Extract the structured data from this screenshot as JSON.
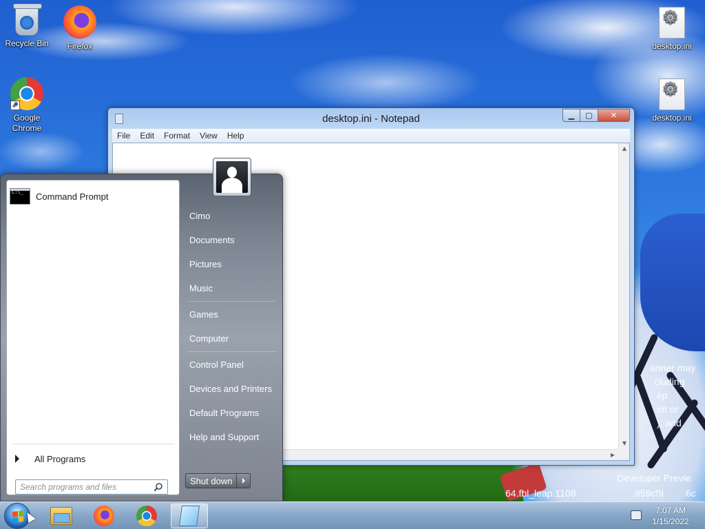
{
  "desktop": {
    "icons": [
      {
        "label": "Recycle Bin"
      },
      {
        "label": "Firefox"
      },
      {
        "label": "Google Chrome"
      },
      {
        "label": "desktop.ini"
      },
      {
        "label": "desktop.ini"
      }
    ],
    "watermark_lines": [
      "anner may",
      "cluding",
      "ep",
      "int or",
      "). and",
      "Developer Previe",
      "64.fbl_leap.1108",
      ".959cf9",
      "6c"
    ]
  },
  "notepad": {
    "title": "desktop.ini - Notepad",
    "menu": [
      "File",
      "Edit",
      "Format",
      "View",
      "Help"
    ],
    "content": ""
  },
  "start_menu": {
    "pinned_programs": [
      {
        "label": "Command Prompt",
        "icon": "C:\\_"
      }
    ],
    "all_programs_label": "All Programs",
    "search_placeholder": "Search programs and files",
    "right_items": [
      {
        "label": "Cimo"
      },
      {
        "label": "Documents"
      },
      {
        "label": "Pictures"
      },
      {
        "label": "Music"
      },
      {
        "label": "Games"
      },
      {
        "label": "Computer"
      },
      {
        "label": "Control Panel"
      },
      {
        "label": "Devices and Printers"
      },
      {
        "label": "Default Programs"
      },
      {
        "label": "Help and Support"
      }
    ],
    "shutdown_label": "Shut down"
  },
  "taskbar": {
    "items": [
      "windows-explorer",
      "firefox",
      "google-chrome",
      "notepad"
    ],
    "active_item": "notepad",
    "clock": {
      "time": "7:07 AM",
      "date": "1/15/2022"
    }
  }
}
